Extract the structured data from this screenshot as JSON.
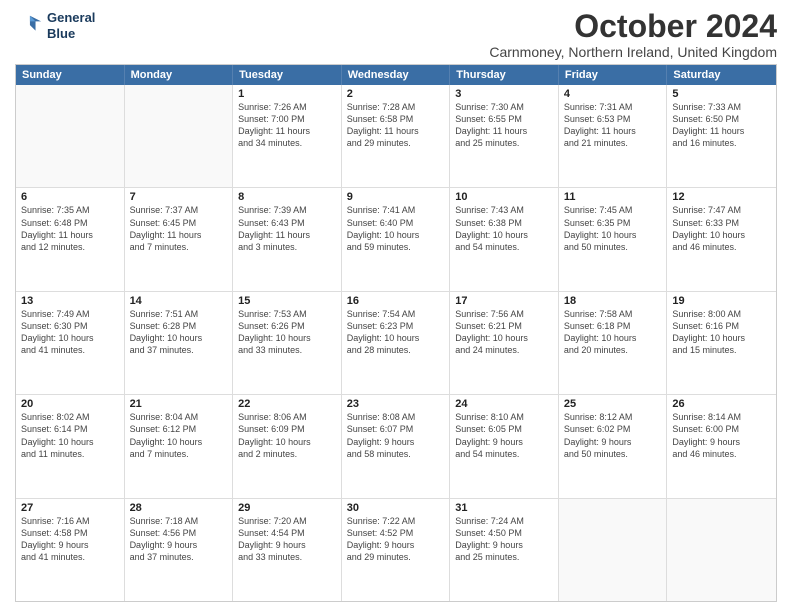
{
  "logo": {
    "line1": "General",
    "line2": "Blue"
  },
  "title": "October 2024",
  "subtitle": "Carnmoney, Northern Ireland, United Kingdom",
  "dayHeaders": [
    "Sunday",
    "Monday",
    "Tuesday",
    "Wednesday",
    "Thursday",
    "Friday",
    "Saturday"
  ],
  "weeks": [
    [
      {
        "day": "",
        "info": ""
      },
      {
        "day": "",
        "info": ""
      },
      {
        "day": "1",
        "info": "Sunrise: 7:26 AM\nSunset: 7:00 PM\nDaylight: 11 hours\nand 34 minutes."
      },
      {
        "day": "2",
        "info": "Sunrise: 7:28 AM\nSunset: 6:58 PM\nDaylight: 11 hours\nand 29 minutes."
      },
      {
        "day": "3",
        "info": "Sunrise: 7:30 AM\nSunset: 6:55 PM\nDaylight: 11 hours\nand 25 minutes."
      },
      {
        "day": "4",
        "info": "Sunrise: 7:31 AM\nSunset: 6:53 PM\nDaylight: 11 hours\nand 21 minutes."
      },
      {
        "day": "5",
        "info": "Sunrise: 7:33 AM\nSunset: 6:50 PM\nDaylight: 11 hours\nand 16 minutes."
      }
    ],
    [
      {
        "day": "6",
        "info": "Sunrise: 7:35 AM\nSunset: 6:48 PM\nDaylight: 11 hours\nand 12 minutes."
      },
      {
        "day": "7",
        "info": "Sunrise: 7:37 AM\nSunset: 6:45 PM\nDaylight: 11 hours\nand 7 minutes."
      },
      {
        "day": "8",
        "info": "Sunrise: 7:39 AM\nSunset: 6:43 PM\nDaylight: 11 hours\nand 3 minutes."
      },
      {
        "day": "9",
        "info": "Sunrise: 7:41 AM\nSunset: 6:40 PM\nDaylight: 10 hours\nand 59 minutes."
      },
      {
        "day": "10",
        "info": "Sunrise: 7:43 AM\nSunset: 6:38 PM\nDaylight: 10 hours\nand 54 minutes."
      },
      {
        "day": "11",
        "info": "Sunrise: 7:45 AM\nSunset: 6:35 PM\nDaylight: 10 hours\nand 50 minutes."
      },
      {
        "day": "12",
        "info": "Sunrise: 7:47 AM\nSunset: 6:33 PM\nDaylight: 10 hours\nand 46 minutes."
      }
    ],
    [
      {
        "day": "13",
        "info": "Sunrise: 7:49 AM\nSunset: 6:30 PM\nDaylight: 10 hours\nand 41 minutes."
      },
      {
        "day": "14",
        "info": "Sunrise: 7:51 AM\nSunset: 6:28 PM\nDaylight: 10 hours\nand 37 minutes."
      },
      {
        "day": "15",
        "info": "Sunrise: 7:53 AM\nSunset: 6:26 PM\nDaylight: 10 hours\nand 33 minutes."
      },
      {
        "day": "16",
        "info": "Sunrise: 7:54 AM\nSunset: 6:23 PM\nDaylight: 10 hours\nand 28 minutes."
      },
      {
        "day": "17",
        "info": "Sunrise: 7:56 AM\nSunset: 6:21 PM\nDaylight: 10 hours\nand 24 minutes."
      },
      {
        "day": "18",
        "info": "Sunrise: 7:58 AM\nSunset: 6:18 PM\nDaylight: 10 hours\nand 20 minutes."
      },
      {
        "day": "19",
        "info": "Sunrise: 8:00 AM\nSunset: 6:16 PM\nDaylight: 10 hours\nand 15 minutes."
      }
    ],
    [
      {
        "day": "20",
        "info": "Sunrise: 8:02 AM\nSunset: 6:14 PM\nDaylight: 10 hours\nand 11 minutes."
      },
      {
        "day": "21",
        "info": "Sunrise: 8:04 AM\nSunset: 6:12 PM\nDaylight: 10 hours\nand 7 minutes."
      },
      {
        "day": "22",
        "info": "Sunrise: 8:06 AM\nSunset: 6:09 PM\nDaylight: 10 hours\nand 2 minutes."
      },
      {
        "day": "23",
        "info": "Sunrise: 8:08 AM\nSunset: 6:07 PM\nDaylight: 9 hours\nand 58 minutes."
      },
      {
        "day": "24",
        "info": "Sunrise: 8:10 AM\nSunset: 6:05 PM\nDaylight: 9 hours\nand 54 minutes."
      },
      {
        "day": "25",
        "info": "Sunrise: 8:12 AM\nSunset: 6:02 PM\nDaylight: 9 hours\nand 50 minutes."
      },
      {
        "day": "26",
        "info": "Sunrise: 8:14 AM\nSunset: 6:00 PM\nDaylight: 9 hours\nand 46 minutes."
      }
    ],
    [
      {
        "day": "27",
        "info": "Sunrise: 7:16 AM\nSunset: 4:58 PM\nDaylight: 9 hours\nand 41 minutes."
      },
      {
        "day": "28",
        "info": "Sunrise: 7:18 AM\nSunset: 4:56 PM\nDaylight: 9 hours\nand 37 minutes."
      },
      {
        "day": "29",
        "info": "Sunrise: 7:20 AM\nSunset: 4:54 PM\nDaylight: 9 hours\nand 33 minutes."
      },
      {
        "day": "30",
        "info": "Sunrise: 7:22 AM\nSunset: 4:52 PM\nDaylight: 9 hours\nand 29 minutes."
      },
      {
        "day": "31",
        "info": "Sunrise: 7:24 AM\nSunset: 4:50 PM\nDaylight: 9 hours\nand 25 minutes."
      },
      {
        "day": "",
        "info": ""
      },
      {
        "day": "",
        "info": ""
      }
    ]
  ]
}
